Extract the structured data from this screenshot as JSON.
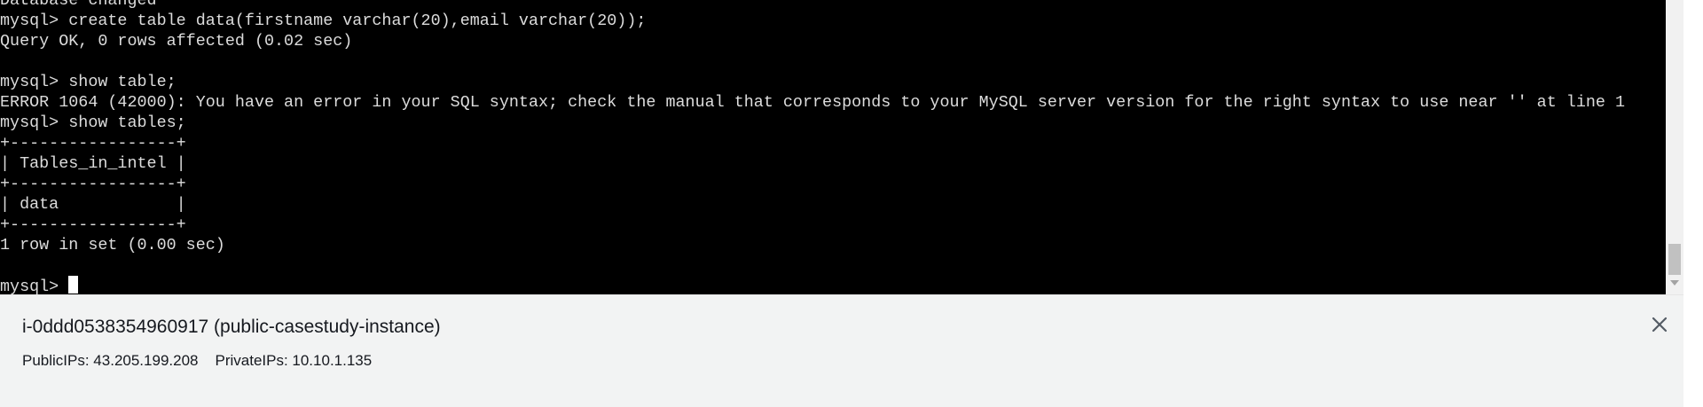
{
  "terminal": {
    "lines": [
      "Database changed",
      "mysql> create table data(firstname varchar(20),email varchar(20));",
      "Query OK, 0 rows affected (0.02 sec)",
      "",
      "mysql> show table;",
      "ERROR 1064 (42000): You have an error in your SQL syntax; check the manual that corresponds to your MySQL server version for the right syntax to use near '' at line 1",
      "mysql> show tables;",
      "+-----------------+",
      "| Tables_in_intel |",
      "+-----------------+",
      "| data            |",
      "+-----------------+",
      "1 row in set (0.00 sec)",
      "",
      "mysql> "
    ]
  },
  "instance": {
    "title": "i-0ddd0538354960917 (public-casestudy-instance)",
    "public_ips_label": "PublicIPs: 43.205.199.208",
    "private_ips_label": "PrivateIPs: 10.10.1.135",
    "close_icon": "close-icon"
  }
}
